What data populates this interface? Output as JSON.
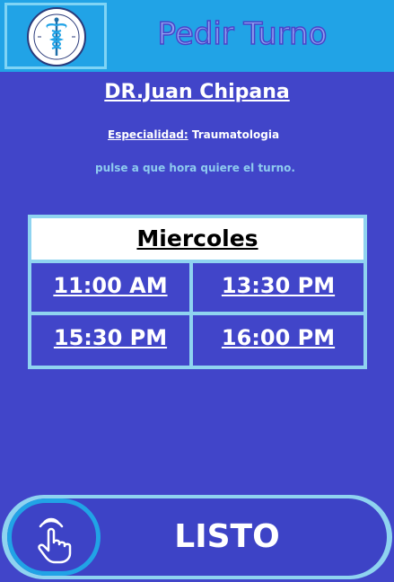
{
  "header": {
    "title": "Pedir Turno",
    "logo_icon": "caduceus-icon"
  },
  "doctor": {
    "name": "DR.Juan Chipana",
    "specialty_label": "Especialidad:",
    "specialty_value": "Traumatologia"
  },
  "instruction": "pulse a que hora quiere el turno.",
  "schedule": {
    "day": "Miercoles",
    "slots": [
      "11:00 AM",
      "13:30 PM",
      "15:30 PM",
      "16:00 PM"
    ]
  },
  "confirm": {
    "label": "LISTO",
    "icon": "tap-hand-icon"
  },
  "colors": {
    "background": "#4145c9",
    "header": "#21a3e6",
    "accent_border": "#8fd3f0"
  }
}
